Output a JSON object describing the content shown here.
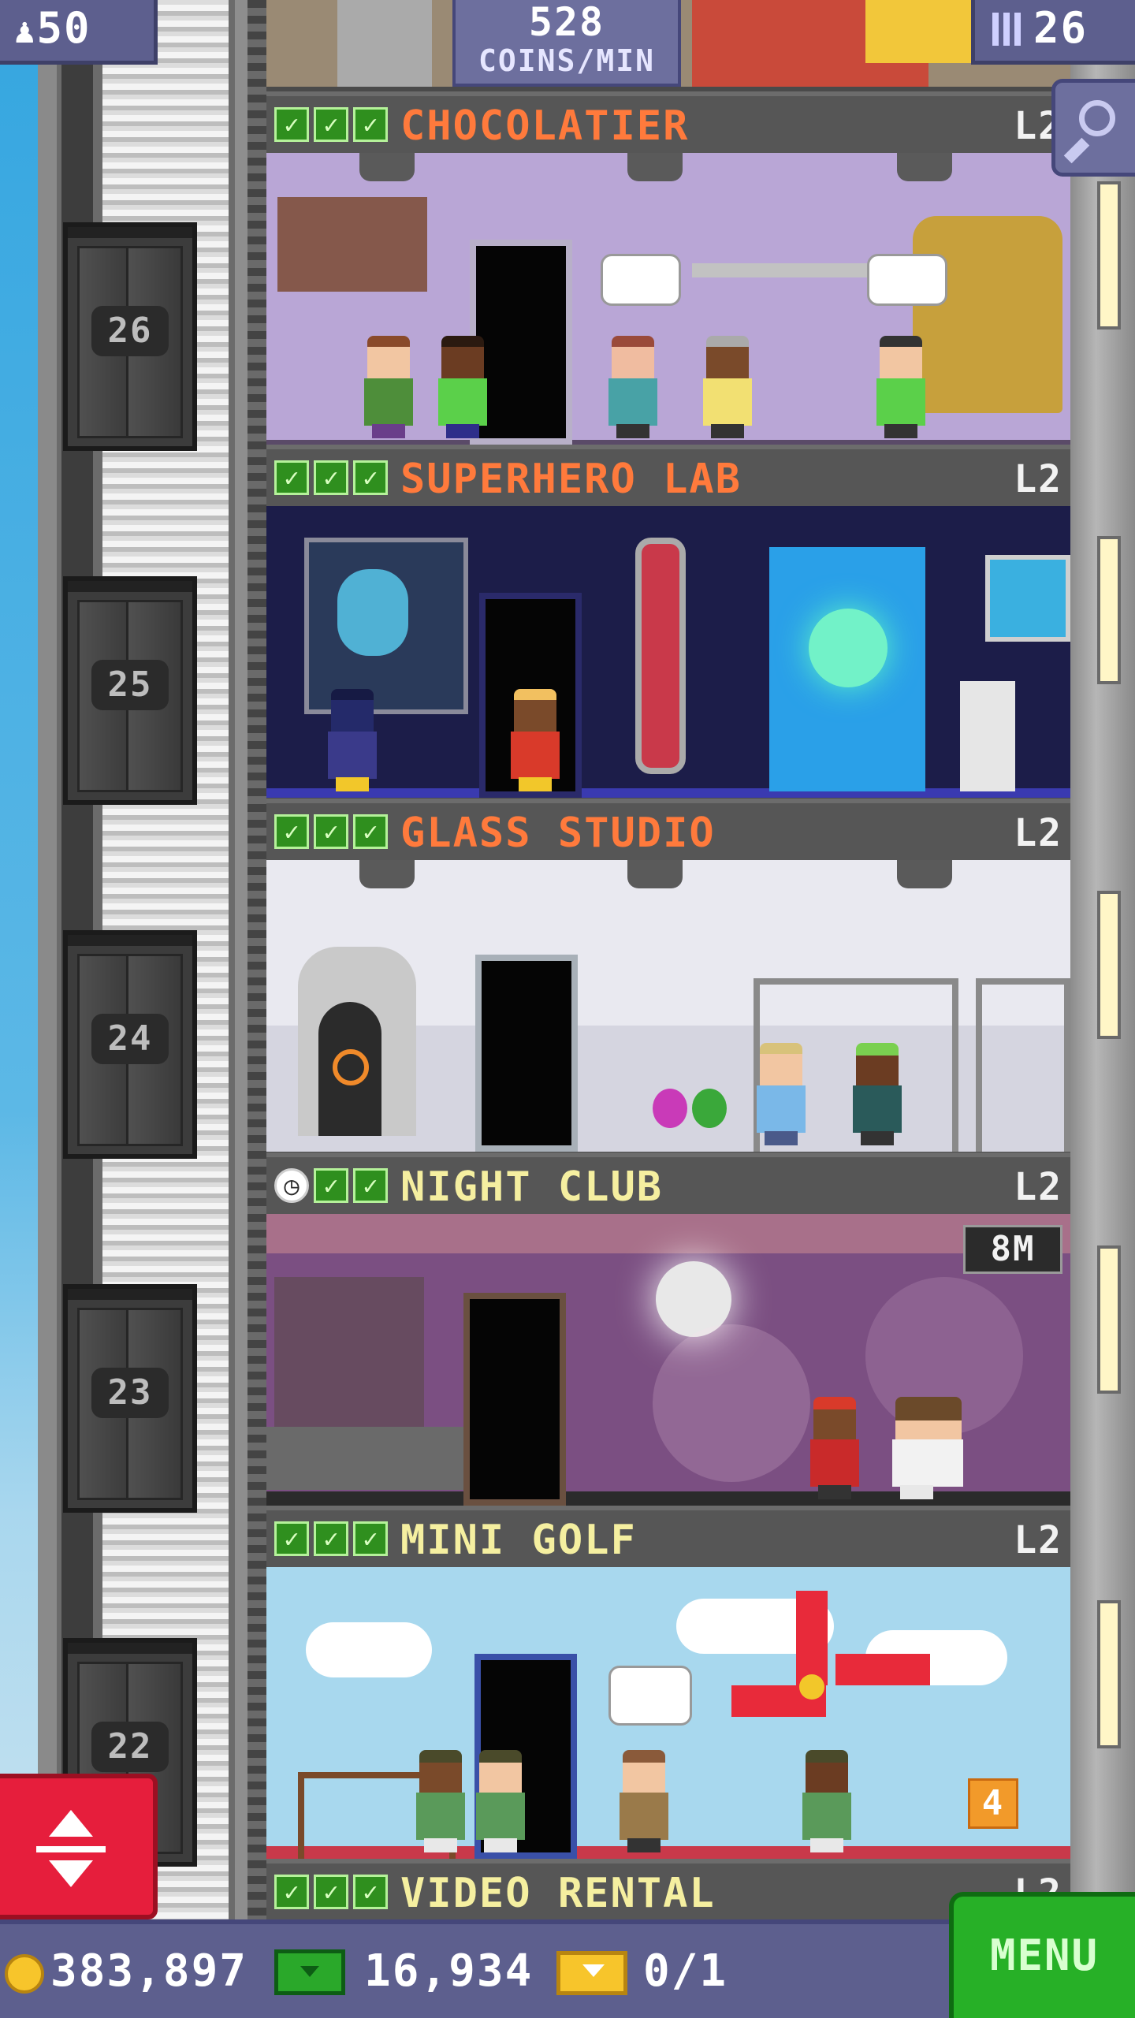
{
  "top_bar": {
    "population": "50",
    "coins_per_min_value": "528",
    "coins_per_min_unit": "COINS/MIN",
    "floor_count": "26",
    "icons": [
      "person-icon",
      "building-icon",
      "magnifier-icon"
    ]
  },
  "elevator": {
    "floor_numbers": [
      "26",
      "25",
      "24",
      "23",
      "22"
    ],
    "control_icon": "up-down-arrows-icon"
  },
  "floors": [
    {
      "name": "CHOCOLATIER",
      "level": "L2",
      "status": [
        "check",
        "check",
        "check"
      ],
      "name_color": "#ff7a3c",
      "room_color": "#b9a6d6"
    },
    {
      "name": "SUPERHERO LAB",
      "level": "L2",
      "status": [
        "check",
        "check",
        "check"
      ],
      "name_color": "#ff7a3c",
      "room_color": "#1c1d49"
    },
    {
      "name": "GLASS STUDIO",
      "level": "L2",
      "status": [
        "check",
        "check",
        "check"
      ],
      "name_color": "#ff7a3c",
      "room_color": "#e9e9f0"
    },
    {
      "name": "NIGHT CLUB",
      "level": "L2",
      "status": [
        "clock",
        "check",
        "check"
      ],
      "name_color": "#f5efa0",
      "room_color": "#7b4f82",
      "timer": "8M"
    },
    {
      "name": "MINI GOLF",
      "level": "L2",
      "status": [
        "check",
        "check",
        "check"
      ],
      "name_color": "#f5efa0",
      "room_color": "#a8d8ee",
      "sign": "4"
    },
    {
      "name": "VIDEO RENTAL",
      "level": "L2",
      "status": [
        "check",
        "check",
        "check"
      ],
      "name_color": "#f5efa0"
    }
  ],
  "bottom_bar": {
    "coins": "383,897",
    "tower_bux": "16,934",
    "tickets": "0/1",
    "menu_label": "MENU"
  },
  "colors": {
    "ui_panel": "#5d5f8e",
    "menu_green": "#27b027",
    "elevator_red": "#e61e3c",
    "check_green": "#2f8f1e"
  }
}
